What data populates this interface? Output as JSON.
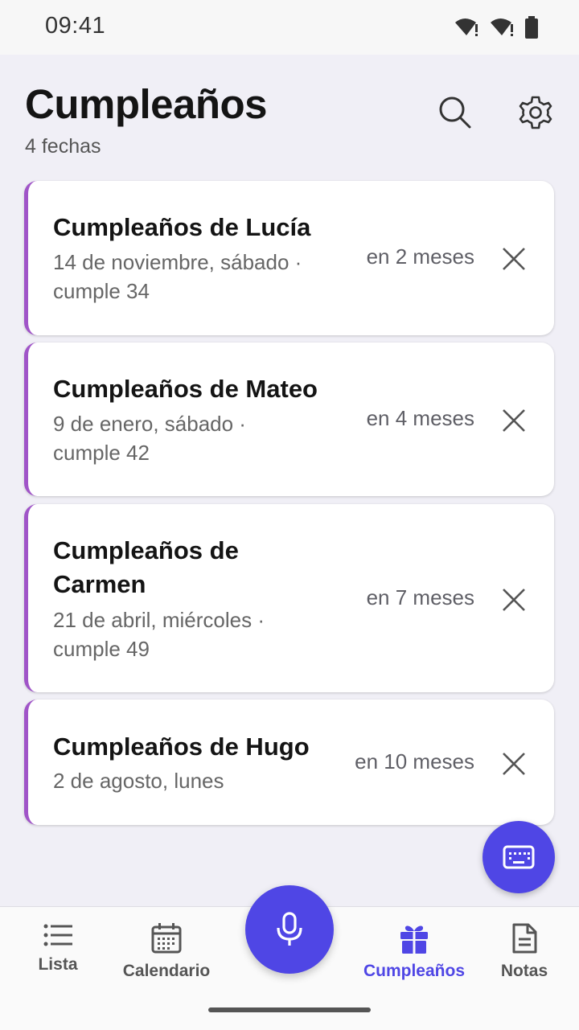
{
  "status": {
    "time": "09:41"
  },
  "header": {
    "title": "Cumpleaños",
    "subtitle": "4 fechas"
  },
  "cards": [
    {
      "title": "Cumpleaños de Lucía",
      "line1": "14 de noviembre, sábado ·",
      "line2": "cumple 34",
      "relative": "en 2 meses"
    },
    {
      "title": "Cumpleaños de Mateo",
      "line1": "9 de enero, sábado ·",
      "line2": "cumple 42",
      "relative": "en 4 meses"
    },
    {
      "title_l1": "Cumpleaños de",
      "title_l2": "Carmen",
      "line1": "21 de abril, miércoles ·",
      "line2": "cumple 49",
      "relative": "en 7 meses"
    },
    {
      "title": "Cumpleaños de Hugo",
      "line1": "2 de agosto, lunes",
      "relative": "en 10 meses"
    }
  ],
  "nav": {
    "items": [
      {
        "label": "Lista",
        "icon": "list-icon"
      },
      {
        "label": "Calendario",
        "icon": "calendar-icon"
      },
      {
        "label": "Cumpleaños",
        "icon": "gift-icon",
        "active": true
      },
      {
        "label": "Notas",
        "icon": "note-icon"
      }
    ]
  },
  "colors": {
    "accent": "#4f46e5",
    "card_stripe": "#a054c8",
    "background": "#f0eff6"
  }
}
